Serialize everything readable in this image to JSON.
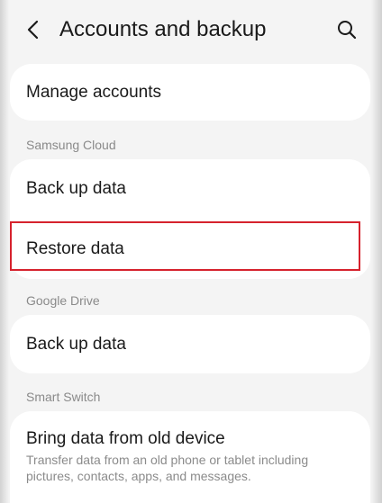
{
  "header": {
    "title": "Accounts and backup",
    "back_icon": "chevron-left-icon",
    "search_icon": "search-icon"
  },
  "accounts": {
    "manage_accounts": "Manage accounts"
  },
  "samsung_cloud": {
    "header": "Samsung Cloud",
    "back_up": "Back up data",
    "restore": "Restore data"
  },
  "google_drive": {
    "header": "Google Drive",
    "back_up": "Back up data"
  },
  "smart_switch": {
    "header": "Smart Switch",
    "bring_data": "Bring data from old device",
    "bring_data_desc_line1": "Transfer data from an old phone or tablet including",
    "bring_data_desc_line2": "pictures, contacts, apps, and messages."
  },
  "colors": {
    "highlight": "#d6222d",
    "background": "#f4f4f4",
    "card": "#ffffff",
    "section_header": "#8a8a8a"
  }
}
